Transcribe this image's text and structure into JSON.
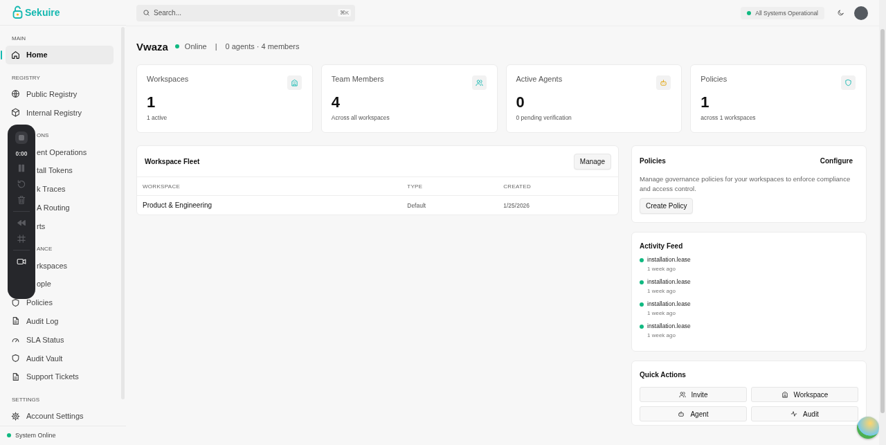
{
  "brand": {
    "name": "Sekuire"
  },
  "search": {
    "placeholder": "Search...",
    "shortcut": "⌘K"
  },
  "status_pill": {
    "label": "All Systems Operational"
  },
  "sidebar": {
    "sections": [
      {
        "title": "MAIN",
        "items": [
          {
            "label": "Home",
            "selected": true
          }
        ]
      },
      {
        "title": "REGISTRY",
        "items": [
          {
            "label": "Public Registry",
            "selected": false
          },
          {
            "label": "Internal Registry",
            "selected": false
          }
        ]
      },
      {
        "title": "ONS",
        "items": [
          {
            "label": "ent Operations",
            "selected": false
          },
          {
            "label": "tall Tokens",
            "selected": false
          },
          {
            "label": "k Traces",
            "selected": false
          },
          {
            "label": "A Routing",
            "selected": false
          },
          {
            "label": "rts",
            "selected": false
          }
        ]
      },
      {
        "title": "ANCE",
        "items": [
          {
            "label": "rkspaces",
            "selected": false
          },
          {
            "label": "ople",
            "selected": false
          },
          {
            "label": "Policies",
            "selected": false
          },
          {
            "label": "Audit Log",
            "selected": false
          },
          {
            "label": "SLA Status",
            "selected": false
          },
          {
            "label": "Audit Vault",
            "selected": false
          },
          {
            "label": "Support Tickets",
            "selected": false
          }
        ]
      },
      {
        "title": "SETTINGS",
        "items": [
          {
            "label": "Account Settings",
            "selected": false
          }
        ]
      }
    ],
    "footer": "System Online"
  },
  "recorder": {
    "time": "0:00"
  },
  "workspace": {
    "name": "Vwaza",
    "status": "Online",
    "separator": "|",
    "summary": "0 agents · 4 members"
  },
  "stats": [
    {
      "label": "Workspaces",
      "value": "1",
      "caption": "1 active"
    },
    {
      "label": "Team Members",
      "value": "4",
      "caption": "Across all workspaces"
    },
    {
      "label": "Active Agents",
      "value": "0",
      "caption": "0 pending verification"
    },
    {
      "label": "Policies",
      "value": "1",
      "caption": "across 1 workspaces"
    }
  ],
  "fleet": {
    "title": "Workspace Fleet",
    "action": "Manage",
    "columns": [
      "WORKSPACE",
      "TYPE",
      "CREATED"
    ],
    "rows": [
      [
        "Product & Engineering",
        "Default",
        "1/25/2026"
      ]
    ]
  },
  "policies": {
    "title": "Policies",
    "action": "Configure",
    "description": "Manage governance policies for your workspaces to enforce compliance and access control.",
    "button": "Create Policy"
  },
  "activity": {
    "title": "Activity Feed",
    "items": [
      {
        "event": "installation.lease",
        "time": "1 week ago"
      },
      {
        "event": "installation.lease",
        "time": "1 week ago"
      },
      {
        "event": "installation.lease",
        "time": "1 week ago"
      },
      {
        "event": "installation.lease",
        "time": "1 week ago"
      }
    ]
  },
  "quick_actions": {
    "title": "Quick Actions",
    "actions": [
      "Invite",
      "Workspace",
      "Agent",
      "Audit"
    ]
  }
}
